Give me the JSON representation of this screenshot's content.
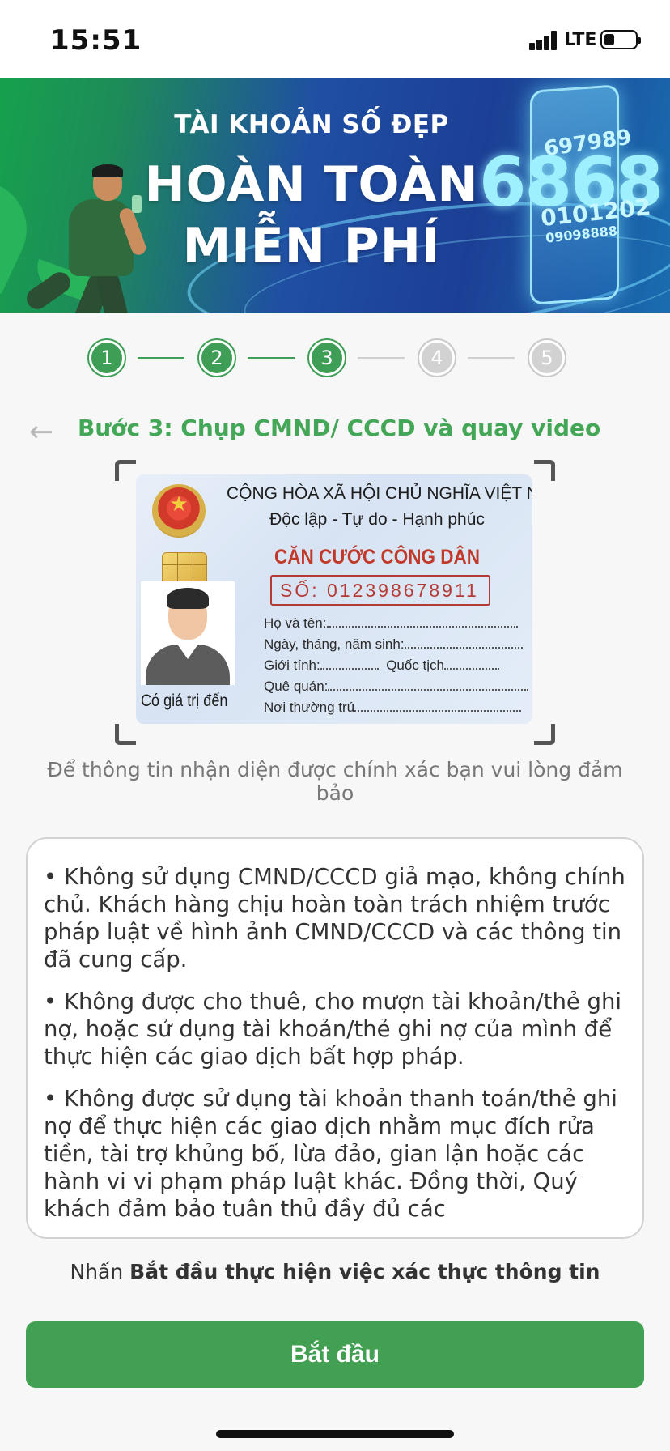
{
  "status_bar": {
    "time": "15:51",
    "network": "LTE"
  },
  "banner": {
    "subtitle": "TÀI KHOẢN SỐ ĐẸP",
    "title_line1": "HOÀN TOÀN",
    "title_line2": "MIỄN PHÍ",
    "numbers": [
      "6868",
      "697989",
      "0101202",
      "09098888"
    ]
  },
  "stepper": {
    "steps": [
      "1",
      "2",
      "3",
      "4",
      "5"
    ],
    "current_step": 3
  },
  "header": {
    "title": "Bước 3: Chụp CMND/ CCCD và quay video"
  },
  "id_card": {
    "nation": "CỘNG HÒA XÃ HỘI CHỦ NGHĨA VIỆT NAM",
    "motto": "Độc lập - Tự do - Hạnh phúc",
    "card_title": "CĂN CƯỚC CÔNG DÂN",
    "number": "SỐ: 012398678911",
    "field_name": "Họ và tên:",
    "field_dob": "Ngày, tháng, năm sinh:",
    "field_gender": "Giới tính:",
    "field_nationality": "Quốc tịch",
    "field_hometown": "Quê quán:",
    "field_residence": "Nơi thường trú",
    "valid_until": "Có giá trị đến"
  },
  "caption": "Để thông tin nhận diện được chính xác bạn vui lòng đảm bảo",
  "notice": {
    "items": [
      "• Không sử dụng CMND/CCCD giả mạo, không chính chủ. Khách hàng chịu hoàn toàn trách nhiệm trước pháp luật về hình ảnh CMND/CCCD và các thông tin đã cung cấp.",
      "• Không được cho thuê, cho mượn tài khoản/thẻ ghi nợ, hoặc sử dụng tài khoản/thẻ ghi nợ của mình để thực hiện các giao dịch bất hợp pháp.",
      "• Không được sử dụng tài khoản thanh toán/thẻ ghi nợ để thực hiện các giao dịch nhằm mục đích rửa tiền, tài trợ khủng bố, lừa đảo, gian lận hoặc các hành vi vi phạm pháp luật khác. Đồng thời, Quý khách đảm bảo tuân thủ đầy đủ các"
    ]
  },
  "instruction": {
    "prefix": "Nhấn ",
    "bold": "Bắt đầu thực hiện việc xác thực thông tin"
  },
  "button": {
    "start_label": "Bắt đầu"
  },
  "colors": {
    "brand_green": "#42a052",
    "step_inactive": "#d2d2d2"
  }
}
